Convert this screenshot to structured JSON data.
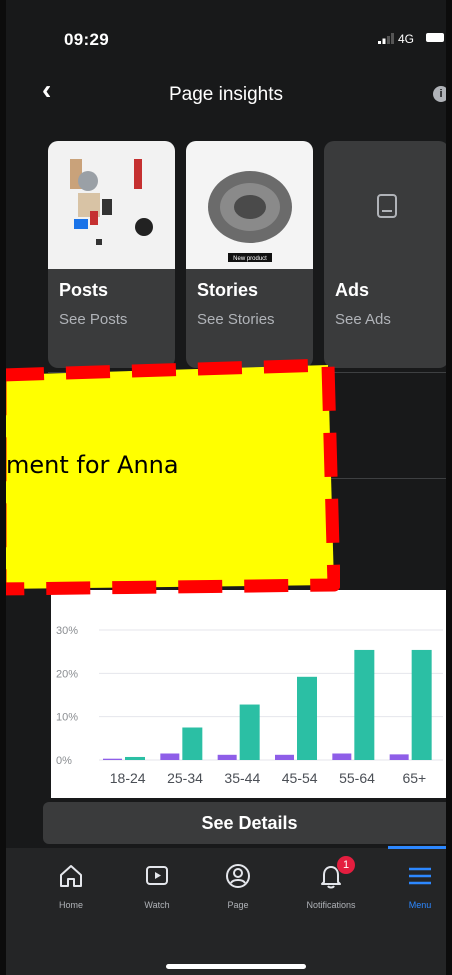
{
  "status_bar": {
    "time": "09:29",
    "network": "4G"
  },
  "header": {
    "title": "Page insights"
  },
  "cards": [
    {
      "title": "Posts",
      "subtitle": "See Posts"
    },
    {
      "title": "Stories",
      "subtitle": "See Stories"
    },
    {
      "title": "Ads",
      "subtitle": "See Ads"
    }
  ],
  "story_caption": "New product",
  "annotation": {
    "text": "ment for Anna"
  },
  "colors": {
    "female": "#8e5ee8",
    "male": "#2bbfa4",
    "accent": "#2d88ff",
    "annotation_fill": "#ffff00",
    "annotation_border": "#ff0000"
  },
  "chart_data": {
    "type": "bar",
    "categories": [
      "18-24",
      "25-34",
      "35-44",
      "45-54",
      "55-64",
      "65+"
    ],
    "series": [
      {
        "values": [
          0.3,
          1.5,
          1.2,
          1.2,
          1.5,
          1.3
        ]
      },
      {
        "values": [
          0.7,
          7.5,
          12.8,
          19.2,
          25.4,
          25.4
        ]
      }
    ],
    "yticks": [
      "0%",
      "10%",
      "20%",
      "30%"
    ],
    "ylim": [
      0,
      30
    ],
    "grid": true
  },
  "see_details_label": "See Details",
  "bottom_nav": [
    {
      "label": "Home",
      "icon": "home-icon"
    },
    {
      "label": "Watch",
      "icon": "watch-icon"
    },
    {
      "label": "Page",
      "icon": "page-icon"
    },
    {
      "label": "Notifications",
      "icon": "bell-icon",
      "badge": "1"
    },
    {
      "label": "Menu",
      "icon": "menu-icon",
      "active": true
    }
  ]
}
